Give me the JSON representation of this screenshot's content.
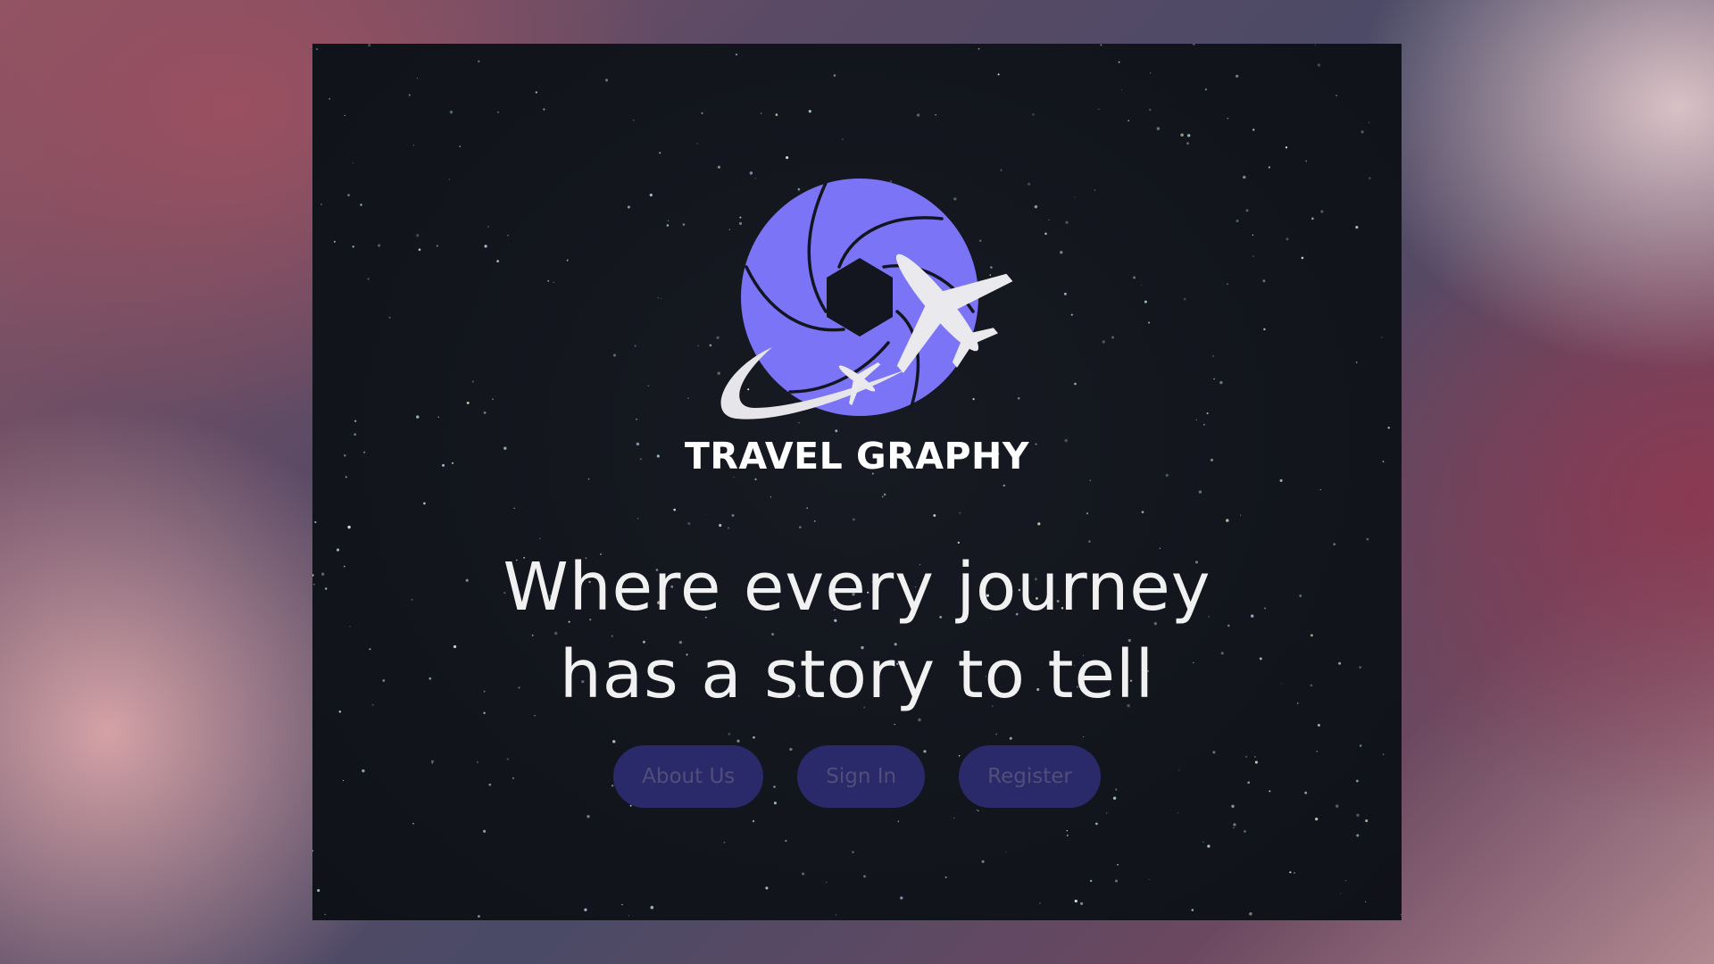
{
  "brand": {
    "name": "TRAVEL GRAPHY"
  },
  "hero": {
    "tagline_line1": "Where every journey",
    "tagline_line2": "has a story to tell"
  },
  "nav": {
    "about_label": "About Us",
    "signin_label": "Sign In",
    "register_label": "Register"
  },
  "colors": {
    "accent": "#7b74f7",
    "button_bg": "#2a2a6a",
    "card_bg": "#12151c"
  },
  "icons": {
    "logo": "camera-aperture-with-airplane-icon"
  }
}
